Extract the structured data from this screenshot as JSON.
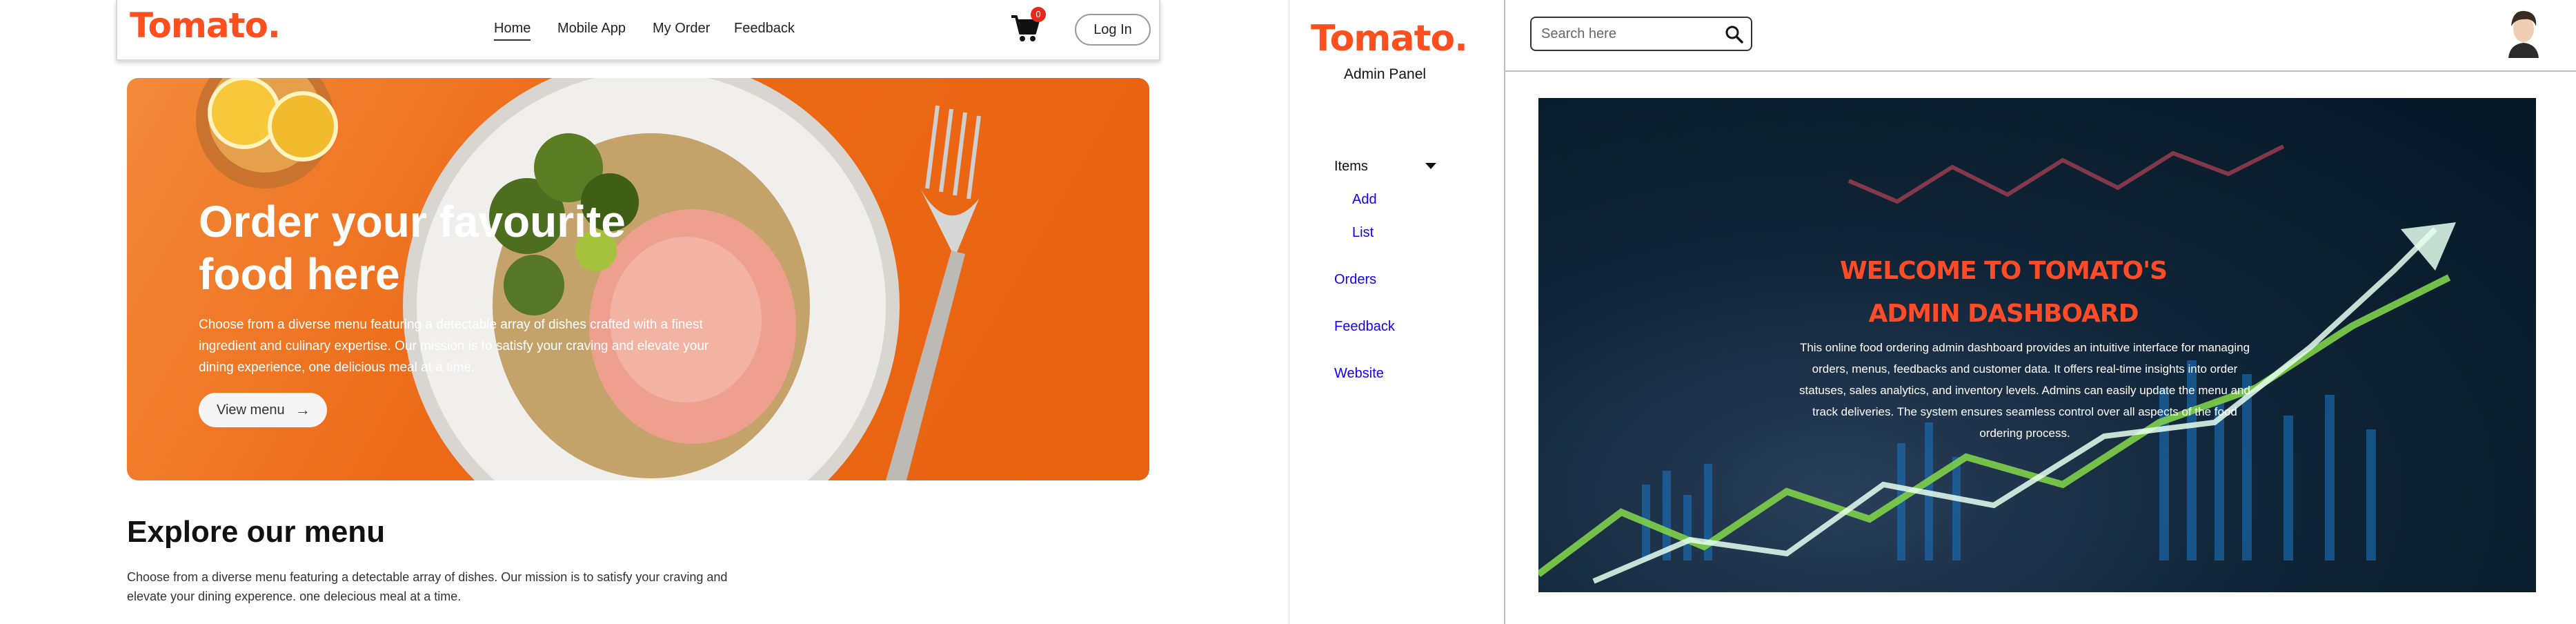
{
  "site": {
    "brand": "Tomato.",
    "nav": {
      "home": "Home",
      "mobile_app": "Mobile App",
      "my_order": "My Order",
      "feedback": "Feedback"
    },
    "cart_count": "0",
    "login_label": "Log In",
    "hero": {
      "title": "Order your favourite food here",
      "description": "Choose from a diverse menu featuring a detectable array of dishes crafted with a finest ingredient and culinary expertise. Our mission is to satisfy your craving and elevate your dining experience, one delicious meal at a time.",
      "button_label": "View menu"
    },
    "explore": {
      "title": "Explore our menu",
      "description": "Choose from a diverse menu featuring a detectable array of dishes. Our mission is to satisfy your craving and elevate your dining experence. one delecious meal at a time."
    }
  },
  "admin": {
    "brand": "Tomato.",
    "panel_label": "Admin Panel",
    "sidebar": {
      "items_label": "Items",
      "add_label": "Add",
      "list_label": "List",
      "orders_label": "Orders",
      "feedback_label": "Feedback",
      "website_label": "Website"
    },
    "search": {
      "placeholder": "Search here"
    },
    "welcome": {
      "title": "WELCOME TO TOMATO'S ADMIN DASHBOARD",
      "description": "This online food ordering admin dashboard provides an intuitive interface for managing orders, menus, feedbacks and customer data. It offers real-time insights into order statuses, sales analytics, and inventory levels. Admins can easily update the menu and track deliveries. The system ensures seamless control over all aspects of the food ordering process."
    }
  },
  "colors": {
    "brand": "#ff4f1f",
    "hero_bg": "#e8620f",
    "link_blue": "#1200ff",
    "badge_red": "#e8281e",
    "dashboard_bg": "#071826"
  },
  "icons": [
    "cart-icon",
    "arrow-right-icon",
    "caret-down-icon",
    "search-icon",
    "user-avatar"
  ]
}
